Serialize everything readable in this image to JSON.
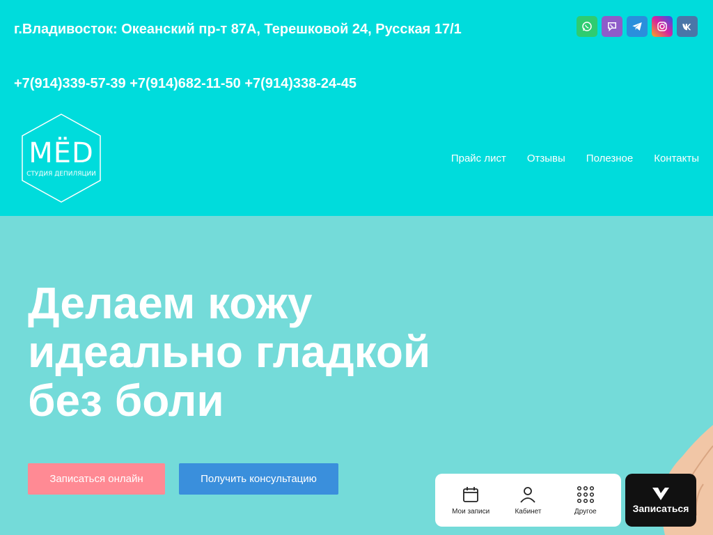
{
  "header": {
    "address": "г.Владивосток: Океанский пр-т 87А, Терешковой 24, Русская 17/1",
    "phones": "+7(914)339-57-39 +7(914)682-11-50 +7(914)338-24-45",
    "bg_color": "#00dcdc"
  },
  "socials": [
    {
      "name": "whatsapp-icon",
      "color": "#2ecc71"
    },
    {
      "name": "viber-icon",
      "color": "#8e5cc9"
    },
    {
      "name": "telegram-icon",
      "color": "#2a8fdc"
    },
    {
      "name": "instagram-icon",
      "color": "#e36f4a"
    },
    {
      "name": "vk-icon",
      "color": "#4a76a8"
    }
  ],
  "logo": {
    "title": "MËD",
    "subtitle": "СТУДИЯ ДЕПИЛЯЦИИ"
  },
  "nav": {
    "items": [
      "Прайс лист",
      "Отзывы",
      "Полезное",
      "Контакты"
    ]
  },
  "hero": {
    "title": "Делаем кожу идеально гладкой без боли",
    "bg_color": "#74dbd9",
    "btn_online": "Записаться онлайн",
    "btn_consult": "Получить консультацию",
    "btn_online_color": "#ff8a94",
    "btn_consult_color": "#3a8fdc"
  },
  "widget": {
    "items": [
      {
        "label": "Мои записи",
        "icon": "calendar-icon"
      },
      {
        "label": "Кабинет",
        "icon": "user-icon"
      },
      {
        "label": "Другое",
        "icon": "grid-icon"
      }
    ],
    "book_label": "Записаться"
  }
}
